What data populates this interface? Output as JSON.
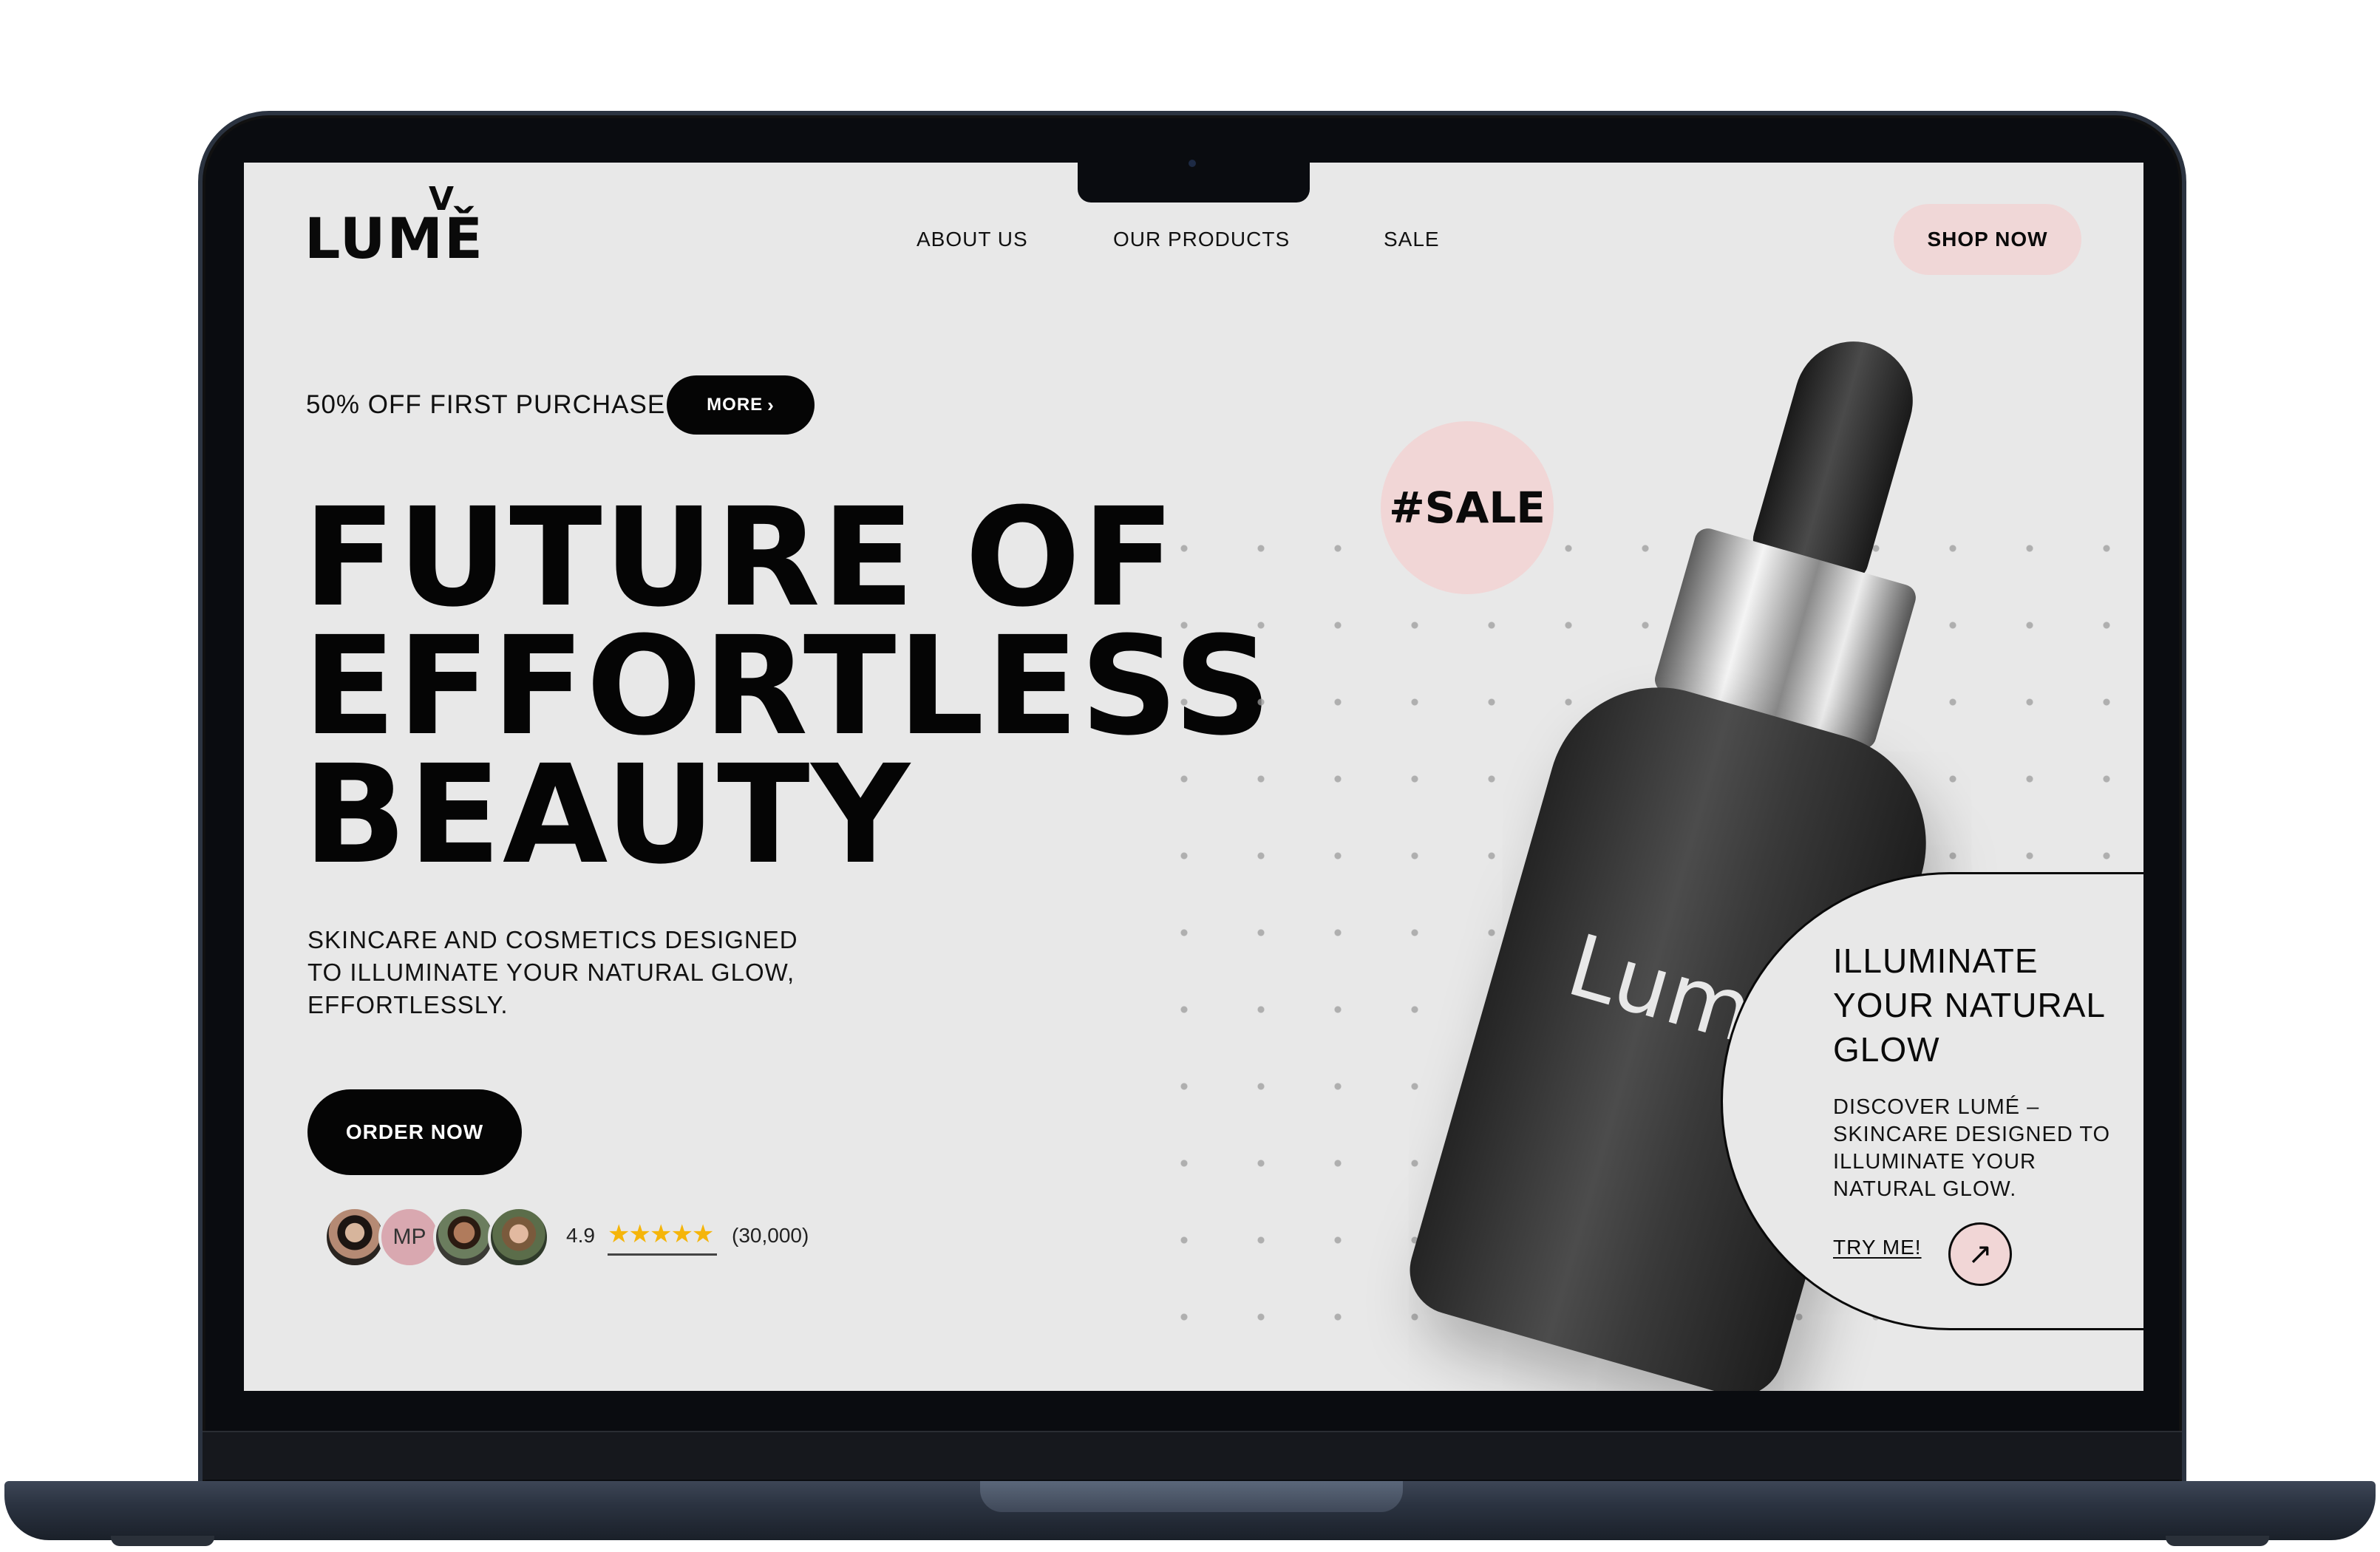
{
  "site": {
    "logo": "LUMĚ",
    "logo_mark": "V",
    "nav": {
      "about": "ABOUT US",
      "products": "OUR PRODUCTS",
      "sale": "SALE"
    },
    "shop_button": "SHOP NOW"
  },
  "promo": {
    "text": "50% OFF FIRST PURCHASE",
    "more_label": "MORE",
    "more_icon": "chevron-right-icon"
  },
  "hero": {
    "title_line1": "FUTURE OF",
    "title_line2": "EFFORTLESS",
    "title_line3": "BEAUTY",
    "subtitle": "SKINCARE AND COSMETICS DESIGNED TO ILLUMINATE YOUR NATURAL GLOW, EFFORTLESSLY.",
    "order_button": "ORDER NOW"
  },
  "social_proof": {
    "avatar_initials": "MP",
    "rating": "4.9",
    "stars": "★★★★★",
    "count": "(30,000)"
  },
  "product": {
    "badge": "#SALE",
    "bottle_label": "Lumě"
  },
  "side_card": {
    "title": "ILLUMINATE YOUR NATURAL GLOW",
    "body": "DISCOVER LUMÉ – SKINCARE DESIGNED TO ILLUMINATE YOUR NATURAL GLOW.",
    "link": "TRY ME!",
    "arrow_icon": "arrow-up-right-icon"
  },
  "colors": {
    "page_bg": "#e8e8e8",
    "accent_pink": "#f1d6d6",
    "primary_black": "#050505",
    "star_gold": "#f5b50a",
    "laptop_frame": "#0a0c10",
    "laptop_base": "#2b3341"
  }
}
